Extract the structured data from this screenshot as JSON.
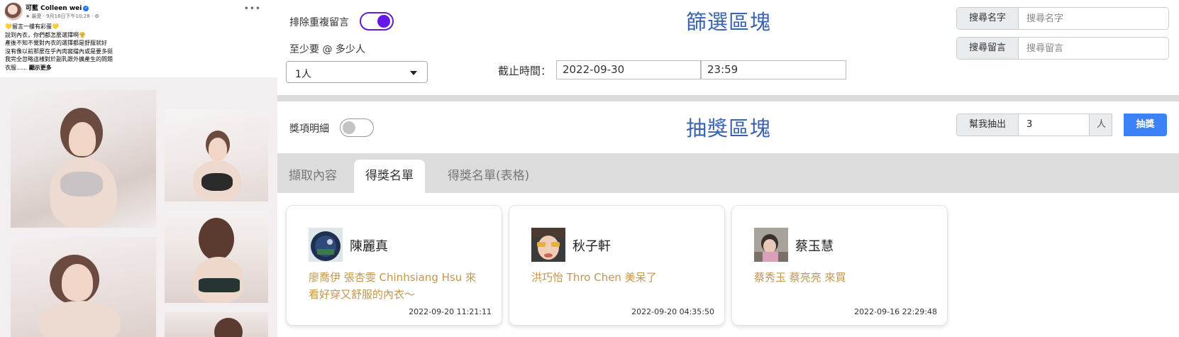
{
  "post": {
    "author": "可藍 Colleen wei",
    "meta": "★ 最愛 · 9月16日下午10:28 · ⚙",
    "more_icon": "more-horizontal-icon",
    "lines": [
      "💛留言一樓有彩蛋💛",
      "說到內衣，你們都怎麼選擇啊😤",
      "產後不知不覺對內衣的選擇都是舒服就好",
      "沒有像以前那麼在乎內肉窩擋內或是要多挺",
      "我完全忽略這樣對於副乳跟外擴產生的問題"
    ],
    "last_line": "衣服......",
    "see_more": "顯示更多"
  },
  "filter": {
    "title": "篩選區塊",
    "exclude_dup_label": "排除重複留言",
    "exclude_dup_on": true,
    "min_tag_label": "至少要 @ 多少人",
    "min_tag_value": "1人",
    "deadline_label": "截止時間：",
    "deadline_date": "2022-09-30",
    "deadline_time": "23:59",
    "search_name_label": "搜尋名字",
    "search_name_placeholder": "搜尋名字",
    "search_comment_label": "搜尋留言",
    "search_comment_placeholder": "搜尋留言"
  },
  "draw": {
    "title": "抽獎區塊",
    "prize_detail_label": "獎項明細",
    "prize_detail_on": false,
    "draw_count_label": "幫我抽出",
    "draw_count_value": "3",
    "unit_label": "人",
    "draw_button": "抽獎"
  },
  "tabs": [
    {
      "label": "擷取內容",
      "active": false
    },
    {
      "label": "得獎名單",
      "active": true
    },
    {
      "label": "得獎名單(表格)",
      "active": false
    }
  ],
  "winners": [
    {
      "name": "陳麗真",
      "comment": "廖喬伊 張杏雯 Chinhsiang Hsu 來看好穿又舒服的內衣～",
      "time": "2022-09-20 11:21:11"
    },
    {
      "name": "秋子軒",
      "comment": "洪巧怡 Thro Chen 美呆了",
      "time": "2022-09-20 04:35:50"
    },
    {
      "name": "蔡玉慧",
      "comment": "蔡秀玉 蔡亮亮 來買",
      "time": "2022-09-16 22:29:48"
    }
  ],
  "colors": {
    "title_blue": "#3a63b0",
    "toggle_purple": "#6419e6",
    "draw_button_blue": "#3b82f6",
    "comment_gold": "#c2964f"
  }
}
